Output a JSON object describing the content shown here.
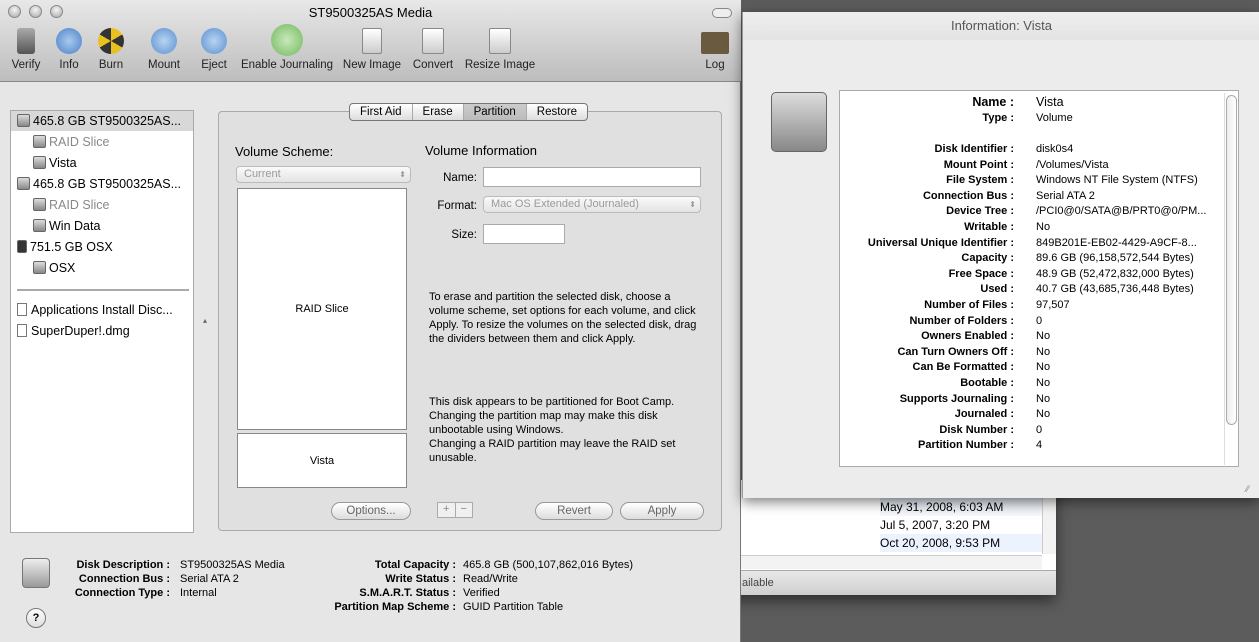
{
  "background_window": {
    "dates": [
      "May 31, 2008, 6:03 AM",
      "Jul 5, 2007, 3:20 PM",
      "Oct 20, 2008, 9:53 PM"
    ],
    "status": "ailable"
  },
  "main_window": {
    "title": "ST9500325AS Media",
    "toolbar": [
      {
        "label": "Verify",
        "icon": "microscope-icon"
      },
      {
        "label": "Info",
        "icon": "info-icon"
      },
      {
        "label": "Burn",
        "icon": "burn-icon"
      },
      {
        "label": "Mount",
        "icon": "mount-icon"
      },
      {
        "label": "Eject",
        "icon": "eject-icon"
      },
      {
        "label": "Enable Journaling",
        "icon": "journaling-icon"
      },
      {
        "label": "New Image",
        "icon": "new-image-icon"
      },
      {
        "label": "Convert",
        "icon": "convert-icon"
      },
      {
        "label": "Resize Image",
        "icon": "resize-image-icon"
      },
      {
        "label": "Log",
        "icon": "log-icon"
      }
    ],
    "sidebar": [
      {
        "label": "465.8 GB ST9500325AS...",
        "level": 0,
        "selected": true
      },
      {
        "label": "RAID Slice",
        "level": 1,
        "dimmed": true
      },
      {
        "label": "Vista",
        "level": 1
      },
      {
        "label": "465.8 GB ST9500325AS...",
        "level": 0
      },
      {
        "label": "RAID Slice",
        "level": 1,
        "dimmed": true
      },
      {
        "label": "Win Data",
        "level": 1
      },
      {
        "label": "751.5 GB OSX",
        "level": 0
      },
      {
        "label": "OSX",
        "level": 1
      }
    ],
    "images": [
      "Applications Install Disc...",
      "SuperDuper!.dmg"
    ],
    "tabs": [
      "First Aid",
      "Erase",
      "Partition",
      "Restore"
    ],
    "selected_tab": "Partition",
    "partition": {
      "volume_scheme_label": "Volume Scheme:",
      "scheme_value": "Current",
      "volumes": [
        "RAID Slice",
        "Vista"
      ],
      "volume_info_label": "Volume Information",
      "name_label": "Name:",
      "name_value": "",
      "format_label": "Format:",
      "format_value": "Mac OS Extended (Journaled)",
      "size_label": "Size:",
      "size_value": "",
      "help_text": "To erase and partition the selected disk, choose a volume scheme, set options for each volume, and click Apply. To resize the volumes on the selected disk, drag the dividers between them and click Apply.",
      "warning_text1": "This disk appears to be partitioned for Boot Camp. Changing the partition map may make this disk unbootable using Windows.",
      "warning_text2": "Changing a RAID partition may leave the RAID set unusable.",
      "add": "+",
      "remove": "−",
      "options": "Options...",
      "revert": "Revert",
      "apply": "Apply"
    },
    "details": {
      "left": [
        [
          "Disk Description",
          "ST9500325AS Media"
        ],
        [
          "Connection Bus",
          "Serial ATA 2"
        ],
        [
          "Connection Type",
          "Internal"
        ]
      ],
      "right": [
        [
          "Total Capacity",
          "465.8 GB (500,107,862,016 Bytes)"
        ],
        [
          "Write Status",
          "Read/Write"
        ],
        [
          "S.M.A.R.T. Status",
          "Verified"
        ],
        [
          "Partition Map Scheme",
          "GUID Partition Table"
        ]
      ]
    },
    "help": "?"
  },
  "info_window": {
    "title": "Information: Vista",
    "name": [
      "Name :",
      "Vista"
    ],
    "type": [
      "Type :",
      "Volume"
    ],
    "rows": [
      [
        "Disk Identifier :",
        "disk0s4"
      ],
      [
        "Mount Point :",
        "/Volumes/Vista"
      ],
      [
        "File System :",
        "Windows NT File System (NTFS)"
      ],
      [
        "Connection Bus :",
        "Serial ATA 2"
      ],
      [
        "Device Tree :",
        "/PCI0@0/SATA@B/PRT0@0/PM..."
      ],
      [
        "Writable :",
        "No"
      ],
      [
        "Universal Unique Identifier :",
        "849B201E-EB02-4429-A9CF-8..."
      ],
      [
        "Capacity :",
        "89.6 GB (96,158,572,544 Bytes)"
      ],
      [
        "Free Space :",
        "48.9 GB (52,472,832,000 Bytes)"
      ],
      [
        "Used :",
        "40.7 GB (43,685,736,448 Bytes)"
      ],
      [
        "Number of Files :",
        "97,507"
      ],
      [
        "Number of Folders :",
        "0"
      ],
      [
        "Owners Enabled :",
        "No"
      ],
      [
        "Can Turn Owners Off :",
        "No"
      ],
      [
        "Can Be Formatted :",
        "No"
      ],
      [
        "Bootable :",
        "No"
      ],
      [
        "Supports Journaling :",
        "No"
      ],
      [
        "Journaled :",
        "No"
      ],
      [
        "Disk Number :",
        "0"
      ],
      [
        "Partition Number :",
        "4"
      ]
    ]
  }
}
